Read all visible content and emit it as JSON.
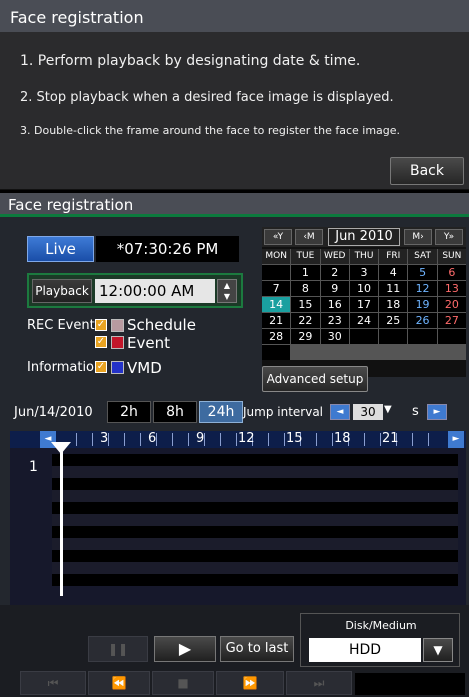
{
  "dialog": {
    "title": "Face registration",
    "steps": [
      "1. Perform playback by designating date & time.",
      "2. Stop playback when a desired face image is displayed.",
      "3. Double-click the frame around the face to register the face image."
    ],
    "back_label": "Back"
  },
  "panel": {
    "title": "Face registration",
    "live_label": "Live",
    "live_time": "*07:30:26 PM",
    "playback_label": "Playback",
    "playback_time": "12:00:00 AM",
    "legend": {
      "rec_event_label": "REC Event",
      "schedule_label": "Schedule",
      "event_label": "Event",
      "information_label": "Information",
      "vmd_label": "VMD"
    },
    "colors": {
      "schedule": "#b89aa0",
      "event": "#c2162a",
      "vmd": "#2432c8",
      "sunday": "#6fb4ff",
      "saturday": "#ff6b6b",
      "today_bg": "#1aa0a0"
    },
    "advanced_label": "Advanced setup"
  },
  "calendar": {
    "nav": {
      "prev_year": "«Y",
      "prev_month": "‹M",
      "next_month": "M›",
      "next_year": "Y»"
    },
    "month": "Jun 2010",
    "weekdays": [
      "MON",
      "TUE",
      "WED",
      "THU",
      "FRI",
      "SAT",
      "SUN"
    ],
    "days": [
      "",
      "1",
      "2",
      "3",
      "4",
      "5",
      "6",
      "7",
      "8",
      "9",
      "10",
      "11",
      "12",
      "13",
      "14",
      "15",
      "16",
      "17",
      "18",
      "19",
      "20",
      "21",
      "22",
      "23",
      "24",
      "25",
      "26",
      "27",
      "28",
      "29",
      "30",
      "",
      "",
      "",
      "",
      ""
    ],
    "today": "14"
  },
  "timeline": {
    "date": "Jun/14/2010",
    "ranges": [
      "2h",
      "8h",
      "24h"
    ],
    "selected_range": "24h",
    "jump_label": "Jump interval",
    "jump_value": "30",
    "jump_unit": "s",
    "hours": [
      "3",
      "6",
      "9",
      "12",
      "15",
      "18",
      "21"
    ],
    "camera": "1"
  },
  "bottom": {
    "goto_label": "Go to last",
    "disk_label": "Disk/Medium",
    "disk_value": "HDD"
  }
}
